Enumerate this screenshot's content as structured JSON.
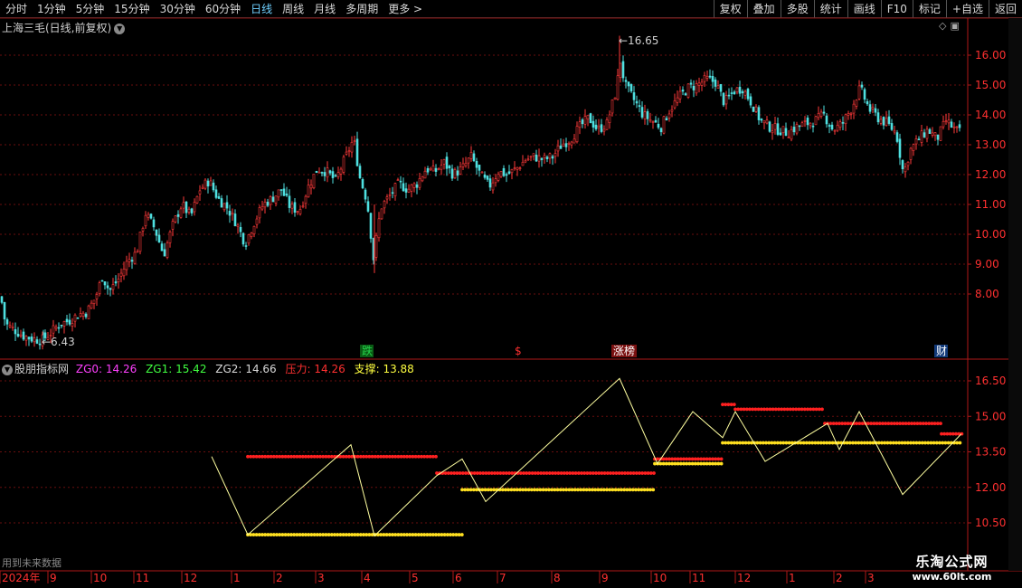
{
  "toolbar": {
    "periods": [
      "分时",
      "1分钟",
      "5分钟",
      "15分钟",
      "30分钟",
      "60分钟",
      "日线",
      "周线",
      "月线",
      "多周期",
      "更多 >"
    ],
    "active_period": "日线",
    "buttons": [
      "复权",
      "叠加",
      "多股",
      "统计",
      "画线",
      "F10",
      "标记",
      "+自选",
      "返回"
    ]
  },
  "main_chart": {
    "title": "上海三毛(日线,前复权)",
    "high_label": "16.65",
    "low_label": "6.43",
    "y_ticks": [
      "16.00",
      "15.00",
      "14.00",
      "13.00",
      "12.00",
      "11.00",
      "10.00",
      "9.00",
      "8.00"
    ],
    "event_markers": [
      {
        "text": "跌",
        "color": "#24d04a"
      },
      {
        "text": "$",
        "color": "#ff3030"
      },
      {
        "text": "涨榜",
        "color": "#ffffff"
      },
      {
        "text": "财",
        "color": "#ffffff"
      }
    ]
  },
  "indicator": {
    "name": "股朋指标网",
    "items": [
      {
        "label": "ZG0:",
        "value": "14.26",
        "color": "#ff40ff"
      },
      {
        "label": "ZG1:",
        "value": "15.42",
        "color": "#40ff40"
      },
      {
        "label": "ZG2:",
        "value": "14.66",
        "color": "#d8d8d8"
      },
      {
        "label": "压力:",
        "value": "14.26",
        "color": "#ff3030"
      },
      {
        "label": "支撑:",
        "value": "13.88",
        "color": "#ffff40"
      }
    ],
    "y_ticks": [
      "16.50",
      "15.00",
      "13.50",
      "12.00",
      "10.50"
    ],
    "future_data_note": "用到未来数据",
    "colors": {
      "zigzag": "#ffffa0",
      "pressure": "#ff2020",
      "support": "#ffe020"
    }
  },
  "time_axis": {
    "labels": [
      "2024年",
      "9",
      "10",
      "11",
      "12",
      "1",
      "2",
      "3",
      "4",
      "5",
      "6",
      "7",
      "8",
      "9",
      "10",
      "11",
      "12",
      "1",
      "2",
      "3"
    ]
  },
  "watermark": {
    "line1": "乐淘公式网",
    "line2": "www.60lt.com"
  },
  "chart_data": {
    "type": "candlestick",
    "title": "上海三毛(日线,前复权)",
    "ylim": [
      6.0,
      17.0
    ],
    "extremes": {
      "high": 16.65,
      "low": 6.43
    },
    "close_path": [
      [
        0,
        7.9
      ],
      [
        5,
        7.0
      ],
      [
        15,
        6.8
      ],
      [
        25,
        6.6
      ],
      [
        35,
        6.5
      ],
      [
        45,
        6.45
      ],
      [
        55,
        6.7
      ],
      [
        65,
        7.0
      ],
      [
        75,
        7.1
      ],
      [
        85,
        7.3
      ],
      [
        95,
        7.4
      ],
      [
        105,
        7.9
      ],
      [
        112,
        8.6
      ],
      [
        120,
        8.1
      ],
      [
        130,
        8.5
      ],
      [
        140,
        9.1
      ],
      [
        150,
        9.4
      ],
      [
        160,
        10.7
      ],
      [
        170,
        10.2
      ],
      [
        180,
        9.3
      ],
      [
        190,
        10.3
      ],
      [
        200,
        11.0
      ],
      [
        210,
        10.6
      ],
      [
        220,
        11.5
      ],
      [
        230,
        11.8
      ],
      [
        240,
        11.2
      ],
      [
        250,
        10.9
      ],
      [
        260,
        10.4
      ],
      [
        270,
        9.7
      ],
      [
        280,
        10.4
      ],
      [
        290,
        11.0
      ],
      [
        300,
        11.2
      ],
      [
        310,
        11.5
      ],
      [
        320,
        10.9
      ],
      [
        330,
        10.8
      ],
      [
        340,
        11.6
      ],
      [
        350,
        12.2
      ],
      [
        360,
        12.1
      ],
      [
        370,
        11.8
      ],
      [
        380,
        12.5
      ],
      [
        390,
        13.2
      ],
      [
        397,
        11.9
      ],
      [
        405,
        11.1
      ],
      [
        412,
        9.2
      ],
      [
        420,
        10.9
      ],
      [
        430,
        11.3
      ],
      [
        440,
        11.7
      ],
      [
        450,
        11.5
      ],
      [
        460,
        11.7
      ],
      [
        470,
        12.2
      ],
      [
        480,
        12.1
      ],
      [
        490,
        12.4
      ],
      [
        500,
        12.0
      ],
      [
        510,
        12.2
      ],
      [
        520,
        12.6
      ],
      [
        530,
        12.0
      ],
      [
        540,
        11.6
      ],
      [
        550,
        12.1
      ],
      [
        560,
        12.0
      ],
      [
        570,
        12.2
      ],
      [
        580,
        12.5
      ],
      [
        590,
        12.6
      ],
      [
        600,
        12.5
      ],
      [
        610,
        12.6
      ],
      [
        620,
        13.0
      ],
      [
        630,
        13.2
      ],
      [
        640,
        13.6
      ],
      [
        650,
        13.9
      ],
      [
        660,
        13.5
      ],
      [
        670,
        13.7
      ],
      [
        680,
        14.8
      ],
      [
        685,
        15.8
      ],
      [
        690,
        15.0
      ],
      [
        700,
        14.5
      ],
      [
        710,
        14.0
      ],
      [
        720,
        13.8
      ],
      [
        730,
        13.6
      ],
      [
        740,
        14.2
      ],
      [
        750,
        14.6
      ],
      [
        760,
        14.9
      ],
      [
        770,
        15.0
      ],
      [
        780,
        15.2
      ],
      [
        790,
        15.1
      ],
      [
        800,
        14.4
      ],
      [
        810,
        14.8
      ],
      [
        820,
        14.9
      ],
      [
        830,
        14.4
      ],
      [
        840,
        13.8
      ],
      [
        850,
        13.6
      ],
      [
        860,
        13.5
      ],
      [
        870,
        13.4
      ],
      [
        880,
        13.6
      ],
      [
        890,
        13.7
      ],
      [
        900,
        13.8
      ],
      [
        910,
        14.0
      ],
      [
        920,
        13.5
      ],
      [
        930,
        13.7
      ],
      [
        940,
        14.2
      ],
      [
        950,
        14.9
      ],
      [
        960,
        14.2
      ],
      [
        970,
        13.9
      ],
      [
        980,
        13.7
      ],
      [
        990,
        13.4
      ],
      [
        998,
        12.0
      ],
      [
        1005,
        12.8
      ],
      [
        1015,
        13.2
      ],
      [
        1025,
        13.5
      ],
      [
        1035,
        13.2
      ],
      [
        1045,
        13.8
      ],
      [
        1055,
        13.5
      ],
      [
        1062,
        13.4
      ]
    ],
    "indicator_ylim": [
      9.6,
      17.1
    ],
    "zigzag": [
      [
        234,
        13.3
      ],
      [
        274,
        10.0
      ],
      [
        388,
        13.8
      ],
      [
        414,
        9.95
      ],
      [
        483,
        12.5
      ],
      [
        511,
        13.2
      ],
      [
        537,
        11.4
      ],
      [
        685,
        16.6
      ],
      [
        727,
        13.0
      ],
      [
        766,
        15.2
      ],
      [
        799,
        14.1
      ],
      [
        813,
        15.2
      ],
      [
        846,
        13.1
      ],
      [
        915,
        14.7
      ],
      [
        928,
        13.6
      ],
      [
        950,
        15.2
      ],
      [
        998,
        11.7
      ],
      [
        1063,
        14.26
      ]
    ],
    "pressure": [
      [
        274,
        483,
        13.3
      ],
      [
        483,
        724,
        12.6
      ],
      [
        724,
        799,
        13.2
      ],
      [
        799,
        813,
        15.5
      ],
      [
        813,
        912,
        15.3
      ],
      [
        912,
        1041,
        14.7
      ],
      [
        1041,
        1064,
        14.26
      ]
    ],
    "support": [
      [
        274,
        511,
        10.0
      ],
      [
        511,
        724,
        11.9
      ],
      [
        724,
        799,
        13.0
      ],
      [
        799,
        1064,
        13.88
      ]
    ]
  }
}
